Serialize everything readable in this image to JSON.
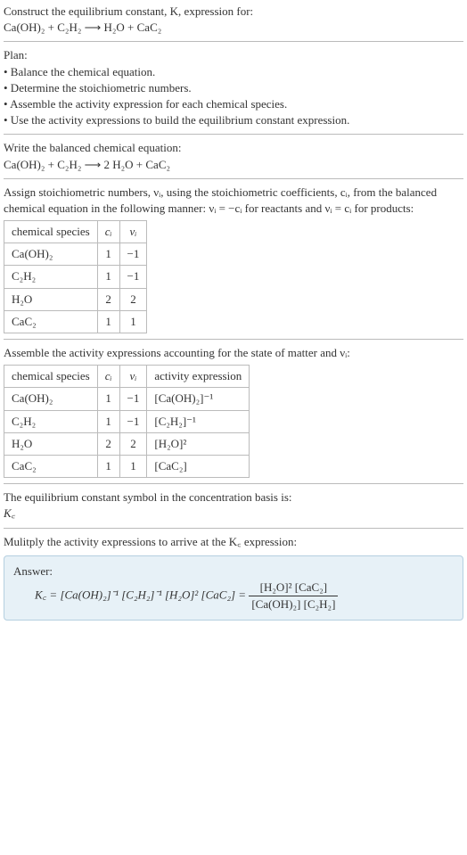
{
  "title_line1": "Construct the equilibrium constant, K, expression for:",
  "title_line2": "Ca(OH)₂ + C₂H₂  ⟶  H₂O + CaC₂",
  "plan_heading": "Plan:",
  "plan_items": [
    "• Balance the chemical equation.",
    "• Determine the stoichiometric numbers.",
    "• Assemble the activity expression for each chemical species.",
    "• Use the activity expressions to build the equilibrium constant expression."
  ],
  "balanced_heading": "Write the balanced chemical equation:",
  "balanced_eq": "Ca(OH)₂ + C₂H₂  ⟶  2 H₂O + CaC₂",
  "stoich_text_a": "Assign stoichiometric numbers, νᵢ, using the stoichiometric coefficients, cᵢ, from the balanced chemical equation in the following manner: νᵢ = −cᵢ for reactants and νᵢ = cᵢ for products:",
  "table1": {
    "headers": [
      "chemical species",
      "cᵢ",
      "νᵢ"
    ],
    "rows": [
      [
        "Ca(OH)₂",
        "1",
        "−1"
      ],
      [
        "C₂H₂",
        "1",
        "−1"
      ],
      [
        "H₂O",
        "2",
        "2"
      ],
      [
        "CaC₂",
        "1",
        "1"
      ]
    ]
  },
  "assemble_text": "Assemble the activity expressions accounting for the state of matter and νᵢ:",
  "table2": {
    "headers": [
      "chemical species",
      "cᵢ",
      "νᵢ",
      "activity expression"
    ],
    "rows": [
      [
        "Ca(OH)₂",
        "1",
        "−1",
        "[Ca(OH)₂]⁻¹"
      ],
      [
        "C₂H₂",
        "1",
        "−1",
        "[C₂H₂]⁻¹"
      ],
      [
        "H₂O",
        "2",
        "2",
        "[H₂O]²"
      ],
      [
        "CaC₂",
        "1",
        "1",
        "[CaC₂]"
      ]
    ]
  },
  "basis_text": "The equilibrium constant symbol in the concentration basis is:",
  "kc_symbol": "K꜀",
  "multiply_text": "Mulitply the activity expressions to arrive at the K꜀ expression:",
  "answer_label": "Answer:",
  "answer_equals": "K꜀ = [Ca(OH)₂]⁻¹ [C₂H₂]⁻¹ [H₂O]² [CaC₂] =",
  "answer_num": "[H₂O]² [CaC₂]",
  "answer_den": "[Ca(OH)₂] [C₂H₂]"
}
